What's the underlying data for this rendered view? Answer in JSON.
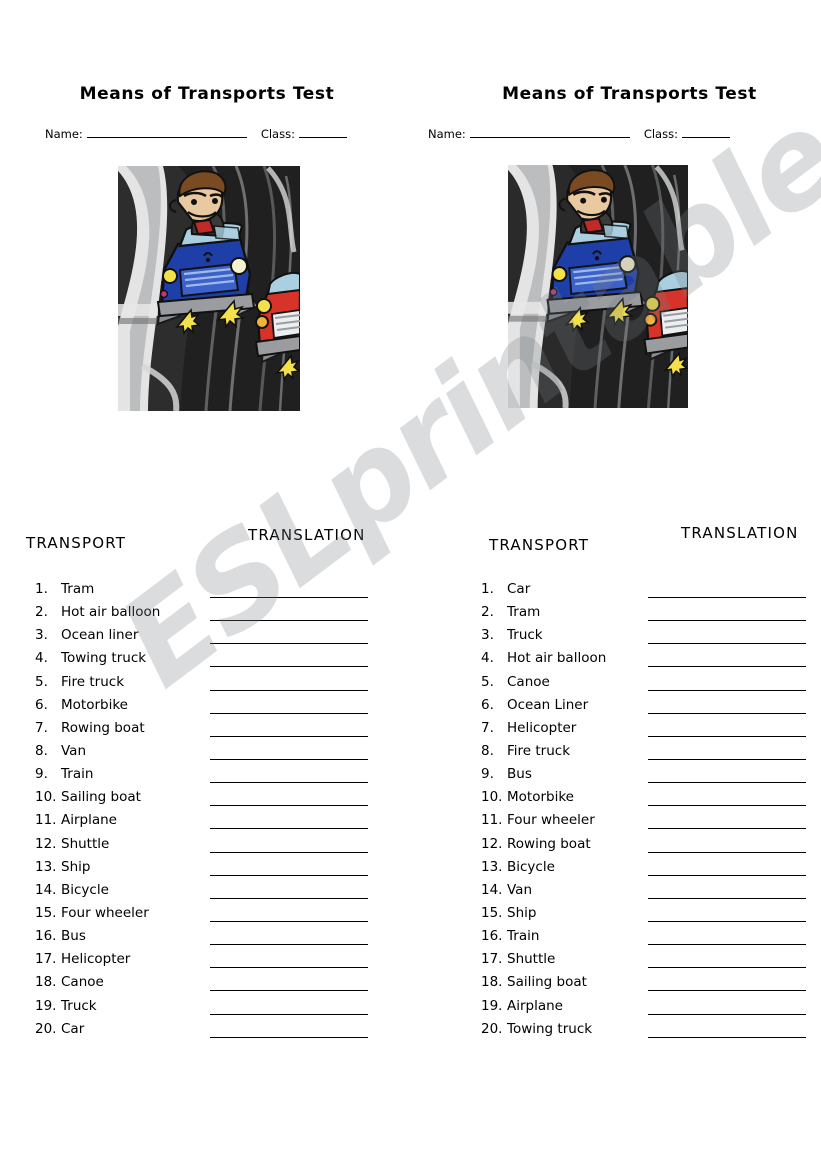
{
  "document": {
    "watermark": "ESLprintables.com",
    "title": "Means of Transports Test"
  },
  "worksheet_left": {
    "title": "Means of Transports Test",
    "name_label": "Name:",
    "name_value": "",
    "class_label": "Class:",
    "class_value": "",
    "image_caption": "cartoon-man-driving-blue-car-on-highway-with-red-truck",
    "header_transport": "TRANSPORT",
    "header_translation": "TRANSLATION",
    "items": [
      {
        "number": "1.",
        "term": "Tram",
        "translation": ""
      },
      {
        "number": "2.",
        "term": "Hot air balloon",
        "translation": ""
      },
      {
        "number": "3.",
        "term": "Ocean liner",
        "translation": ""
      },
      {
        "number": "4.",
        "term": "Towing truck",
        "translation": ""
      },
      {
        "number": "5.",
        "term": "Fire truck",
        "translation": ""
      },
      {
        "number": "6.",
        "term": "Motorbike",
        "translation": ""
      },
      {
        "number": "7.",
        "term": "Rowing boat",
        "translation": ""
      },
      {
        "number": "8.",
        "term": "Van",
        "translation": ""
      },
      {
        "number": "9.",
        "term": "Train",
        "translation": ""
      },
      {
        "number": "10.",
        "term": "Sailing boat",
        "translation": ""
      },
      {
        "number": "11.",
        "term": "Airplane",
        "translation": ""
      },
      {
        "number": "12.",
        "term": "Shuttle",
        "translation": ""
      },
      {
        "number": "13.",
        "term": "Ship",
        "translation": ""
      },
      {
        "number": "14.",
        "term": "Bicycle",
        "translation": ""
      },
      {
        "number": "15.",
        "term": "Four wheeler",
        "translation": ""
      },
      {
        "number": "16.",
        "term": "Bus",
        "translation": ""
      },
      {
        "number": "17.",
        "term": "Helicopter",
        "translation": ""
      },
      {
        "number": "18.",
        "term": "Canoe",
        "translation": ""
      },
      {
        "number": "19.",
        "term": "Truck",
        "translation": ""
      },
      {
        "number": "20.",
        "term": "Car",
        "translation": ""
      }
    ]
  },
  "worksheet_right": {
    "title": "Means of Transports Test",
    "name_label": "Name:",
    "name_value": "",
    "class_label": "Class:",
    "class_value": "",
    "image_caption": "cartoon-man-driving-blue-car-on-highway-with-red-truck",
    "header_transport": "TRANSPORT",
    "header_translation": "TRANSLATION",
    "items": [
      {
        "number": "1.",
        "term": "Car",
        "translation": ""
      },
      {
        "number": "2.",
        "term": "Tram",
        "translation": ""
      },
      {
        "number": "3.",
        "term": "Truck",
        "translation": ""
      },
      {
        "number": "4.",
        "term": "Hot air balloon",
        "translation": ""
      },
      {
        "number": "5.",
        "term": "Canoe",
        "translation": ""
      },
      {
        "number": "6.",
        "term": "Ocean Liner",
        "translation": ""
      },
      {
        "number": "7.",
        "term": "Helicopter",
        "translation": ""
      },
      {
        "number": "8.",
        "term": "Fire truck",
        "translation": ""
      },
      {
        "number": "9.",
        "term": "Bus",
        "translation": ""
      },
      {
        "number": "10.",
        "term": "Motorbike",
        "translation": ""
      },
      {
        "number": "11.",
        "term": "Four wheeler",
        "translation": ""
      },
      {
        "number": "12.",
        "term": "Rowing boat",
        "translation": ""
      },
      {
        "number": "13.",
        "term": "Bicycle",
        "translation": ""
      },
      {
        "number": "14.",
        "term": "Van",
        "translation": ""
      },
      {
        "number": "15.",
        "term": "Ship",
        "translation": ""
      },
      {
        "number": "16.",
        "term": "Train",
        "translation": ""
      },
      {
        "number": "17.",
        "term": "Shuttle",
        "translation": ""
      },
      {
        "number": "18.",
        "term": "Sailing boat",
        "translation": ""
      },
      {
        "number": "19.",
        "term": "Airplane",
        "translation": ""
      },
      {
        "number": "20.",
        "term": "Towing truck",
        "translation": ""
      }
    ]
  },
  "colors": {
    "page_background": "#ffffff",
    "text": "#000000",
    "watermark": "#c8cacd",
    "car_blue": "#1f3fa8",
    "car_blue_light": "#2f56c6",
    "car_red": "#d8332a",
    "road_dark": "#262626",
    "road_gray": "#8d8f91",
    "skin": "#e8c9a0",
    "hair_brown": "#7a4a22",
    "shirt_red": "#c02a28",
    "headlight_yellow": "#f3e04a",
    "bumper_gray": "#9a9ca0"
  }
}
